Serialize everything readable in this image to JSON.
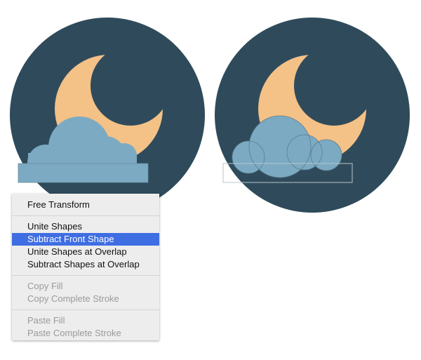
{
  "colors": {
    "badge_background": "#2f4b5b",
    "moon": "#f4c187",
    "cloud": "#7caac3",
    "menu_background": "#ededed",
    "menu_highlight": "#3f6ee3"
  },
  "context_menu": {
    "groups": [
      [
        {
          "label": "Free Transform",
          "state": "normal"
        }
      ],
      [
        {
          "label": "Unite Shapes",
          "state": "normal"
        },
        {
          "label": "Subtract Front Shape",
          "state": "selected"
        },
        {
          "label": "Unite Shapes at Overlap",
          "state": "normal"
        },
        {
          "label": "Subtract Shapes at Overlap",
          "state": "normal"
        }
      ],
      [
        {
          "label": "Copy Fill",
          "state": "disabled"
        },
        {
          "label": "Copy Complete Stroke",
          "state": "disabled"
        }
      ],
      [
        {
          "label": "Paste Fill",
          "state": "disabled"
        },
        {
          "label": "Paste Complete Stroke",
          "state": "disabled"
        }
      ]
    ]
  }
}
